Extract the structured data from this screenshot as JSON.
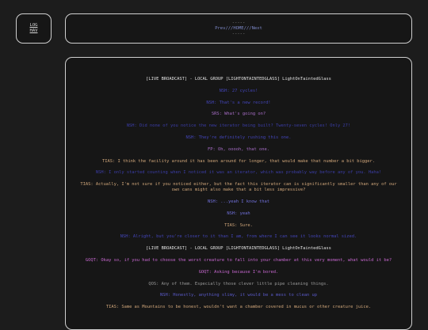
{
  "log": {
    "label": "LOG\nHAV"
  },
  "nav": {
    "dashes_top": "-----",
    "prev": "Prev",
    "sep1": "///",
    "home": "HOME",
    "sep2": "///",
    "next": "Next",
    "dashes_bottom": "-----"
  },
  "chat": [
    {
      "style": "c-head",
      "text": "[LIVE BROADCAST] - LOCAL GROUP [LIGHTONTAINTEDGLASS] LightOnTaintedGlass"
    },
    {
      "style": "c-nsh",
      "text": "NSH: 27 cycles!"
    },
    {
      "style": "c-nsh",
      "text": "NSH: That's a new record!"
    },
    {
      "style": "c-sig",
      "text": "SRS: What's going on?"
    },
    {
      "style": "c-nsh2",
      "text": "NSH: Did none of you notice the new iterator being built? Twenty-seven cycles! Only 27!"
    },
    {
      "style": "c-nsh",
      "text": "NSH: They're definitely rushing this one."
    },
    {
      "style": "c-sig",
      "text": "FP: Oh, ooooh, that one."
    },
    {
      "style": "c-tias",
      "text": "TIAS: I think the facility around it has been around for longer, that would make that number a bit bigger."
    },
    {
      "style": "c-nsh2",
      "text": "NSH: I only started counting when I noticed it was an iterator, which was probably way before any of you. Haha!"
    },
    {
      "style": "c-tias",
      "text": "TIAS: Actually, I'm not sure if you noticed either, but the fact this iterator can is significantly smaller than any of our own cans might also make that a bit less impressive?"
    },
    {
      "style": "c-pb",
      "text": "NSH: ...yeah I know that"
    },
    {
      "style": "c-pb",
      "text": "NSH: yeah"
    },
    {
      "style": "c-tias",
      "text": "TIAS: Sure."
    },
    {
      "style": "c-nsh",
      "text": "NSH: Alright, but you're closer to it than I am, from where I can see it looks normal sized."
    },
    {
      "style": "c-head",
      "text": "[LIVE BROADCAST] - LOCAL GROUP [LIGHTONTAINTEDGLASS] LightOnTaintedGlass"
    },
    {
      "style": "c-gqf",
      "text": "GOQT: Okay so, if you had to choose the worst creature to fall into your chamber at this very moment, what would it be?"
    },
    {
      "style": "c-gqf",
      "text": "GOQT: Asking because I'm bored."
    },
    {
      "style": "c-qos",
      "text": "QOS: Any of them. Especially those clever little pipe cleaning things."
    },
    {
      "style": "c-bpm",
      "text": "NSH: Honestly, anything slimy, it would be a mess to clean up"
    },
    {
      "style": "c-tias",
      "text": "TIAS: Same as Mountains to be honest, wouldn't want a chamber covered in mucus or other creature juice."
    }
  ]
}
